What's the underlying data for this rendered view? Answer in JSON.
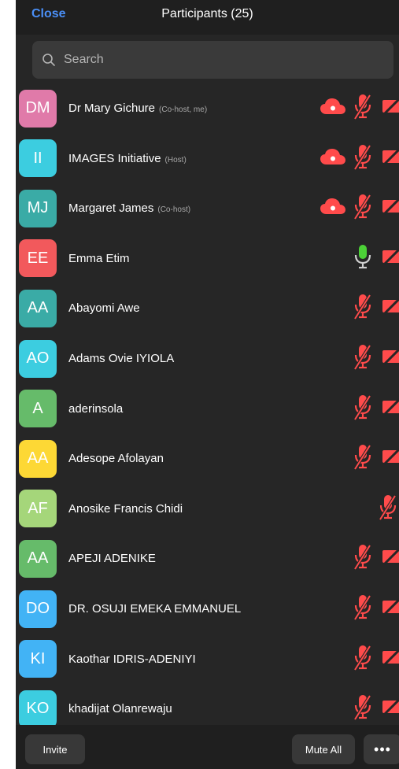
{
  "header": {
    "close_label": "Close",
    "title": "Participants (25)"
  },
  "search": {
    "placeholder": "Search"
  },
  "colors": {
    "accent": "#4a8ff7",
    "muted": "#ff4b4b",
    "mic_on": "#4cd137"
  },
  "participants": [
    {
      "initials": "DM",
      "name": "Dr Mary Gichure",
      "role": "(Co-host, me)",
      "avatar_color": "#e07aa9",
      "cloud": true,
      "mic": "muted",
      "video": true
    },
    {
      "initials": "II",
      "name": "IMAGES Initiative",
      "role": "(Host)",
      "avatar_color": "#3ccde0",
      "cloud": true,
      "mic": "muted",
      "video": true
    },
    {
      "initials": "MJ",
      "name": "Margaret James",
      "role": "(Co-host)",
      "avatar_color": "#3aaba6",
      "cloud": true,
      "mic": "muted",
      "video": true
    },
    {
      "initials": "EE",
      "name": "Emma Etim",
      "role": "",
      "avatar_color": "#f2595c",
      "cloud": false,
      "mic": "on",
      "video": true
    },
    {
      "initials": "AA",
      "name": "Abayomi Awe",
      "role": "",
      "avatar_color": "#3aaba6",
      "cloud": false,
      "mic": "muted",
      "video": true
    },
    {
      "initials": "AO",
      "name": "Adams Ovie IYIOLA",
      "role": "",
      "avatar_color": "#3ccde0",
      "cloud": false,
      "mic": "muted",
      "video": true
    },
    {
      "initials": "A",
      "name": "aderinsola",
      "role": "",
      "avatar_color": "#66bb6a",
      "cloud": false,
      "mic": "muted",
      "video": true
    },
    {
      "initials": "AA",
      "name": "Adesope Afolayan",
      "role": "",
      "avatar_color": "#fdd835",
      "cloud": false,
      "mic": "muted",
      "video": true
    },
    {
      "initials": "AF",
      "name": "Anosike Francis Chidi",
      "role": "",
      "avatar_color": "#a5d67a",
      "cloud": false,
      "mic": "muted",
      "video": false
    },
    {
      "initials": "AA",
      "name": "APEJI ADENIKE",
      "role": "",
      "avatar_color": "#66bb6a",
      "cloud": false,
      "mic": "muted",
      "video": true
    },
    {
      "initials": "DO",
      "name": "DR. OSUJI EMEKA EMMANUEL",
      "role": "",
      "avatar_color": "#42b3f5",
      "cloud": false,
      "mic": "muted",
      "video": true
    },
    {
      "initials": "KI",
      "name": "Kaothar IDRIS-ADENIYI",
      "role": "",
      "avatar_color": "#42b3f5",
      "cloud": false,
      "mic": "muted",
      "video": true
    },
    {
      "initials": "KO",
      "name": "khadijat Olanrewaju",
      "role": "",
      "avatar_color": "#3ccde0",
      "cloud": false,
      "mic": "muted",
      "video": true
    }
  ],
  "footer": {
    "invite_label": "Invite",
    "mute_all_label": "Mute All",
    "more_label": "•••"
  }
}
